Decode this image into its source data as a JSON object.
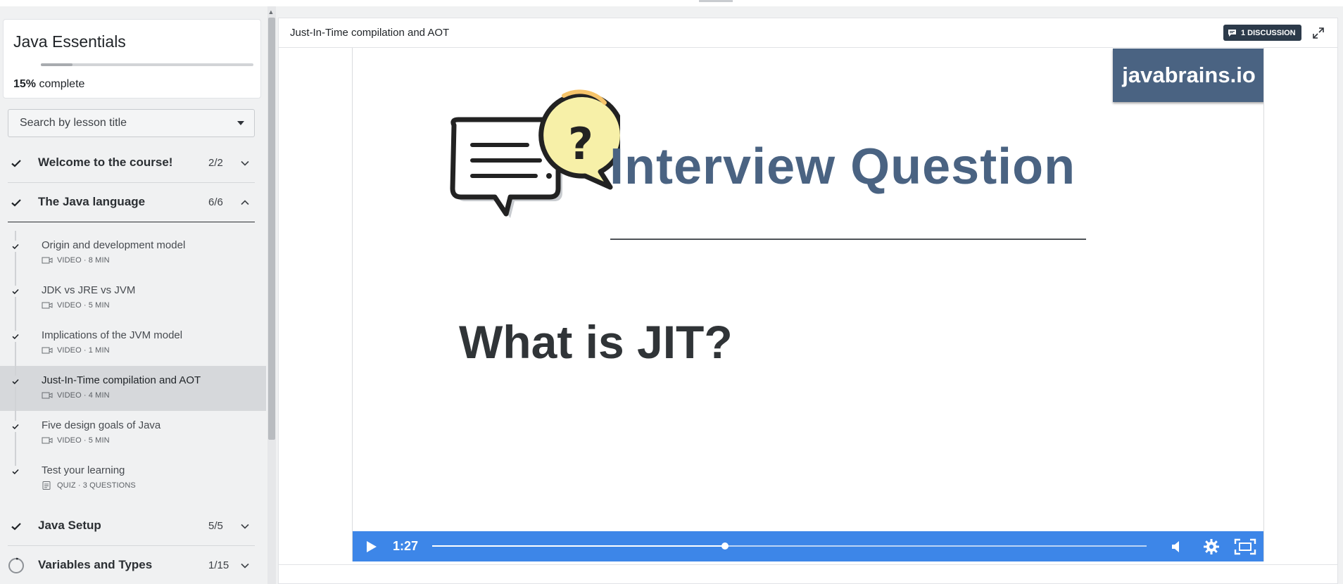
{
  "course": {
    "title": "Java Essentials",
    "progress_percent": 15,
    "progress_value": "15%",
    "progress_suffix": "complete"
  },
  "search": {
    "placeholder": "Search by lesson title"
  },
  "sections": [
    {
      "title": "Welcome to the course!",
      "count": "2/2",
      "status": "complete",
      "expanded": false
    },
    {
      "title": "The Java language",
      "count": "6/6",
      "status": "complete",
      "expanded": true
    },
    {
      "title": "Java Setup",
      "count": "5/5",
      "status": "complete",
      "expanded": false
    },
    {
      "title": "Variables and Types",
      "count": "1/15",
      "status": "in-progress",
      "expanded": false
    }
  ],
  "lessons": [
    {
      "title": "Origin and development model",
      "meta": "VIDEO · 8 MIN",
      "icon": "video-icon",
      "active": false
    },
    {
      "title": "JDK vs JRE vs JVM",
      "meta": "VIDEO · 5 MIN",
      "icon": "video-icon",
      "active": false
    },
    {
      "title": "Implications of the JVM model",
      "meta": "VIDEO · 1 MIN",
      "icon": "video-icon",
      "active": false
    },
    {
      "title": "Just-In-Time compilation and AOT",
      "meta": "VIDEO · 4 MIN",
      "icon": "video-icon",
      "active": true
    },
    {
      "title": "Five design goals of Java",
      "meta": "VIDEO · 5 MIN",
      "icon": "video-icon",
      "active": false
    },
    {
      "title": "Test your learning",
      "meta": "QUIZ · 3 QUESTIONS",
      "icon": "quiz-icon",
      "active": false
    }
  ],
  "main": {
    "lesson_title": "Just-In-Time compilation and AOT",
    "discussion_label": "1 DISCUSSION"
  },
  "slide": {
    "logo": "javabrains.io",
    "heading": "Interview Question",
    "question": "What is JIT?"
  },
  "player": {
    "time": "1:27",
    "progress_fraction": 0.41
  },
  "colors": {
    "accent_blue": "#3d86e8",
    "slide_heading": "#4a6382",
    "discussion_bg": "#2c3a4a"
  }
}
